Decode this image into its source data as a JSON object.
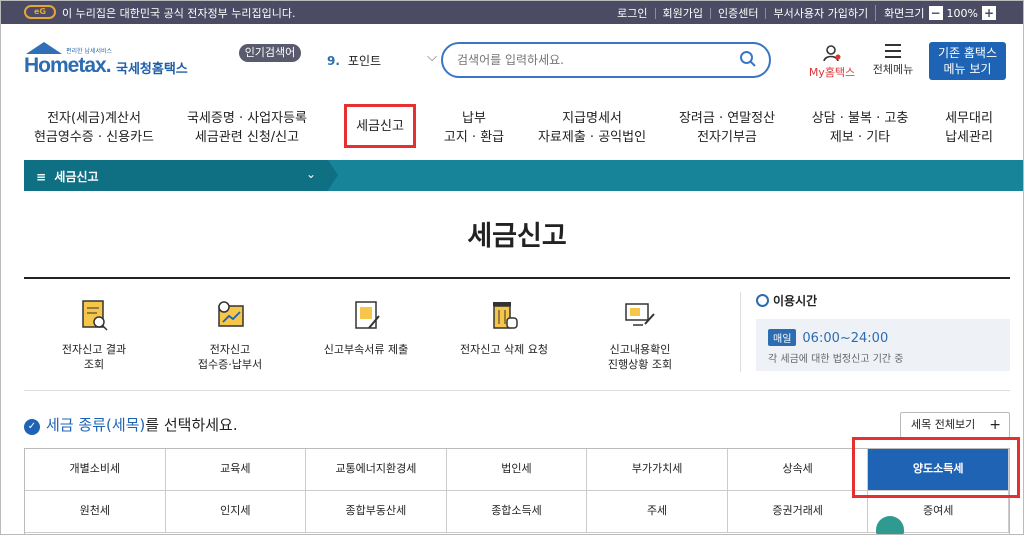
{
  "gov_bar": {
    "logo_text": "eG",
    "message": "이 누리집은 대한민국 공식 전자정부 누리집입니다.",
    "links": [
      "로그인",
      "회원가입",
      "인증센터",
      "부서사용자 가입하기"
    ],
    "zoom_label": "화면크기",
    "zoom_value": "100%",
    "zoom_minus": "−",
    "zoom_plus": "+"
  },
  "brand": {
    "small_text": "편리한 납세서비스",
    "logo_text": "Hometax.",
    "korean_name": "국세청홈택스"
  },
  "popular_search": {
    "tag": "인기검색어",
    "rank": "9.",
    "keyword": "포인트"
  },
  "search": {
    "placeholder": "검색어를 입력하세요."
  },
  "header_buttons": {
    "my_hometax": "My홈택스",
    "all_menu": "전체메뉴",
    "old_menu_line1": "기존 홈택스",
    "old_menu_line2": "메뉴 보기"
  },
  "gnb": [
    {
      "line1": "전자(세금)계산서",
      "line2": "현금영수증 · 신용카드"
    },
    {
      "line1": "국세증명 · 사업자등록",
      "line2": "세금관련 신청/신고"
    },
    {
      "line1": "세금신고",
      "line2": ""
    },
    {
      "line1": "납부",
      "line2": "고지 · 환급"
    },
    {
      "line1": "지급명세서",
      "line2": "자료제출 · 공익법인"
    },
    {
      "line1": "장려금 · 연말정산",
      "line2": "전자기부금"
    },
    {
      "line1": "상담 · 불복 · 고충",
      "line2": "제보 · 기타"
    },
    {
      "line1": "세무대리",
      "line2": "납세관리"
    }
  ],
  "breadcrumb": {
    "menu_icon": "≡",
    "label": "세금신고",
    "chevron": "⌄"
  },
  "page_title": "세금신고",
  "services": [
    {
      "line1": "전자신고 결과",
      "line2": "조회",
      "icon": "document-search-icon"
    },
    {
      "line1": "전자신고",
      "line2": "접수증·납부서",
      "icon": "receipt-clock-icon"
    },
    {
      "line1": "신고부속서류 제출",
      "line2": "",
      "icon": "document-pen-icon"
    },
    {
      "line1": "전자신고 삭제 요청",
      "line2": "",
      "icon": "trash-hand-icon"
    },
    {
      "line1": "신고내용확인",
      "line2": "진행상황 조회",
      "icon": "monitor-pen-icon"
    }
  ],
  "hours": {
    "title": "이용시간",
    "badge": "매일",
    "time": "06:00~24:00",
    "note": "각 세금에 대한 법정신고 기간 중"
  },
  "select_heading": {
    "check": "✓",
    "highlight": "세금 종류(세목)",
    "rest": "를 선택하세요."
  },
  "all_view_button": {
    "label": "세목 전체보기",
    "icon": "+"
  },
  "tax_types": [
    "개별소비세",
    "교육세",
    "교통에너지환경세",
    "법인세",
    "부가가치세",
    "상속세",
    "양도소득세",
    "원천세",
    "인지세",
    "종합부동산세",
    "종합소득세",
    "주세",
    "증권거래세",
    "증여세"
  ],
  "selected_tax": "양도소득세",
  "colors": {
    "primary": "#1f64b4",
    "teal": "#17849a",
    "highlight_red": "#e53030",
    "gov_bar": "#4b4b63"
  }
}
